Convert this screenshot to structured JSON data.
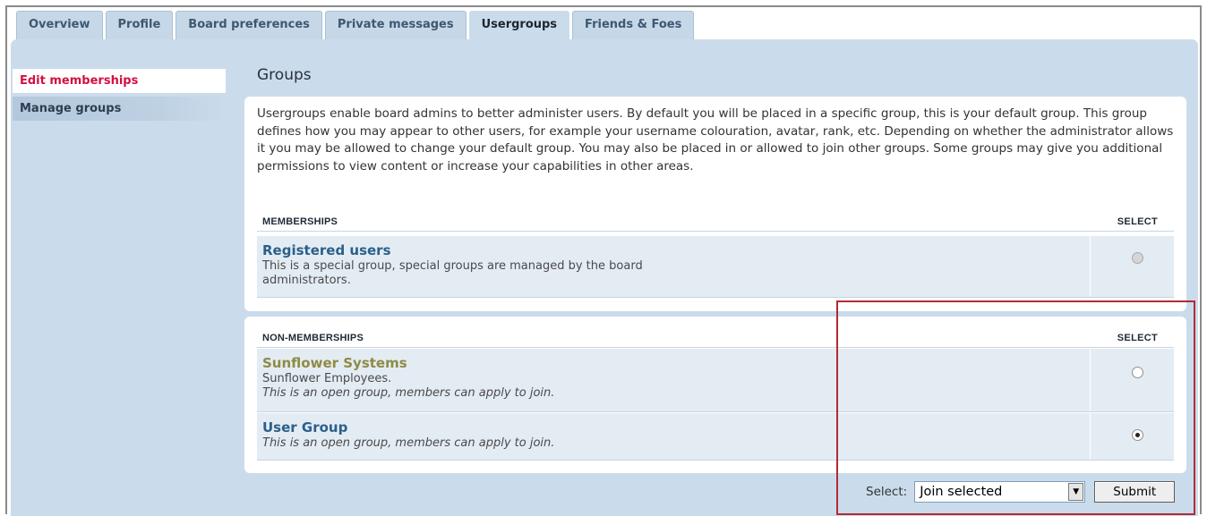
{
  "tabs": [
    {
      "label": "Overview",
      "active": false
    },
    {
      "label": "Profile",
      "active": false
    },
    {
      "label": "Board preferences",
      "active": false
    },
    {
      "label": "Private messages",
      "active": false
    },
    {
      "label": "Usergroups",
      "active": true
    },
    {
      "label": "Friends & Foes",
      "active": false
    }
  ],
  "sidebar": {
    "items": [
      {
        "label": "Edit memberships",
        "active": true
      },
      {
        "label": "Manage groups",
        "active": false
      }
    ]
  },
  "main": {
    "title": "Groups",
    "intro": "Usergroups enable board admins to better administer users. By default you will be placed in a specific group, this is your default group. This group defines how you may appear to other users, for example your username colouration, avatar, rank, etc. Depending on whether the administrator allows it you may be allowed to change your default group. You may also be placed in or allowed to join other groups. Some groups may give you additional permissions to view content or increase your capabilities in other areas.",
    "memberships": {
      "header": "MEMBERSHIPS",
      "select_header": "SELECT",
      "groups": [
        {
          "name": "Registered users",
          "description": "This is a special group, special groups are managed by the board administrators.",
          "radio_state": "disabled"
        }
      ]
    },
    "non_memberships": {
      "header": "NON-MEMBERSHIPS",
      "select_header": "SELECT",
      "groups": [
        {
          "name": "Sunflower Systems",
          "description": "Sunflower Employees.",
          "note": "This is an open group, members can apply to join.",
          "radio_state": "unchecked"
        },
        {
          "name": "User Group",
          "note": "This is an open group, members can apply to join.",
          "radio_state": "checked"
        }
      ]
    },
    "controls": {
      "select_label": "Select:",
      "select_value": "Join selected",
      "submit_label": "Submit"
    }
  },
  "colors": {
    "panel_bg": "#cadceb",
    "active_link": "#d31141",
    "group_link": "#2b5f8a",
    "special_group": "#8f8b44",
    "highlight": "#b22a34"
  }
}
